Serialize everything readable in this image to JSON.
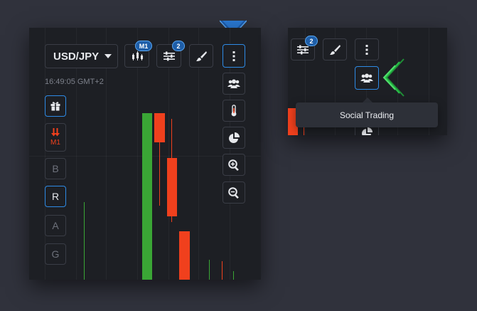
{
  "main": {
    "pair_label": "USD/JPY",
    "time": "16:49:05 GMT+2",
    "toolbar": {
      "chart_type_badge": "M1",
      "indicators_badge": "2"
    },
    "side_buttons": {
      "expiration_label": "M1",
      "b": "B",
      "r": "R",
      "a": "A",
      "g": "G"
    }
  },
  "mini": {
    "indicators_badge": "2",
    "tooltip": "Social Trading"
  },
  "colors": {
    "accent_blue": "#2e8be6",
    "up_green": "#3aa635",
    "down_red": "#f0401d",
    "pointer_green": "#29c24a"
  }
}
